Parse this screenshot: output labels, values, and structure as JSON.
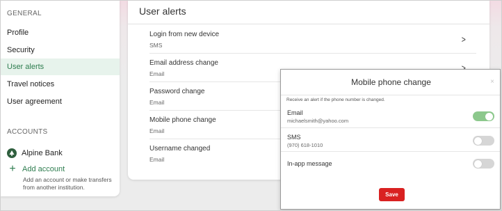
{
  "sidebar": {
    "general_heading": "GENERAL",
    "items": [
      {
        "label": "Profile",
        "active": false
      },
      {
        "label": "Security",
        "active": false
      },
      {
        "label": "User alerts",
        "active": true
      },
      {
        "label": "Travel notices",
        "active": false
      },
      {
        "label": "User agreement",
        "active": false
      }
    ],
    "accounts_heading": "ACCOUNTS",
    "bank_name": "Alpine Bank",
    "add_account_label": "Add account",
    "add_account_desc": "Add an account or make transfers from another institution."
  },
  "main": {
    "title": "User alerts",
    "alerts": [
      {
        "title": "Login from new device",
        "subtitle": "SMS"
      },
      {
        "title": "Email address change",
        "subtitle": "Email"
      },
      {
        "title": "Password change",
        "subtitle": "Email"
      },
      {
        "title": "Mobile phone change",
        "subtitle": "Email"
      },
      {
        "title": "Username changed",
        "subtitle": "Email"
      }
    ]
  },
  "modal": {
    "title": "Mobile phone change",
    "close_symbol": "×",
    "description": "Receive an alert if the phone number is changed.",
    "options": [
      {
        "title": "Email",
        "subtitle": "michaelsmith@yahoo.com",
        "enabled": true
      },
      {
        "title": "SMS",
        "subtitle": "(970) 618-1010",
        "enabled": false
      },
      {
        "title": "In-app message",
        "subtitle": "",
        "enabled": false
      }
    ],
    "save_label": "Save"
  },
  "colors": {
    "accent_green": "#2e7d4f",
    "active_bg": "#e7f3ec",
    "toggle_on": "#8cc88c",
    "toggle_off": "#d6d6d6",
    "save_red": "#d92121"
  },
  "icons": {
    "chevron": "chevron-right-icon",
    "plus": "plus-icon",
    "bank_logo": "tree-logo-icon",
    "close": "close-icon"
  }
}
